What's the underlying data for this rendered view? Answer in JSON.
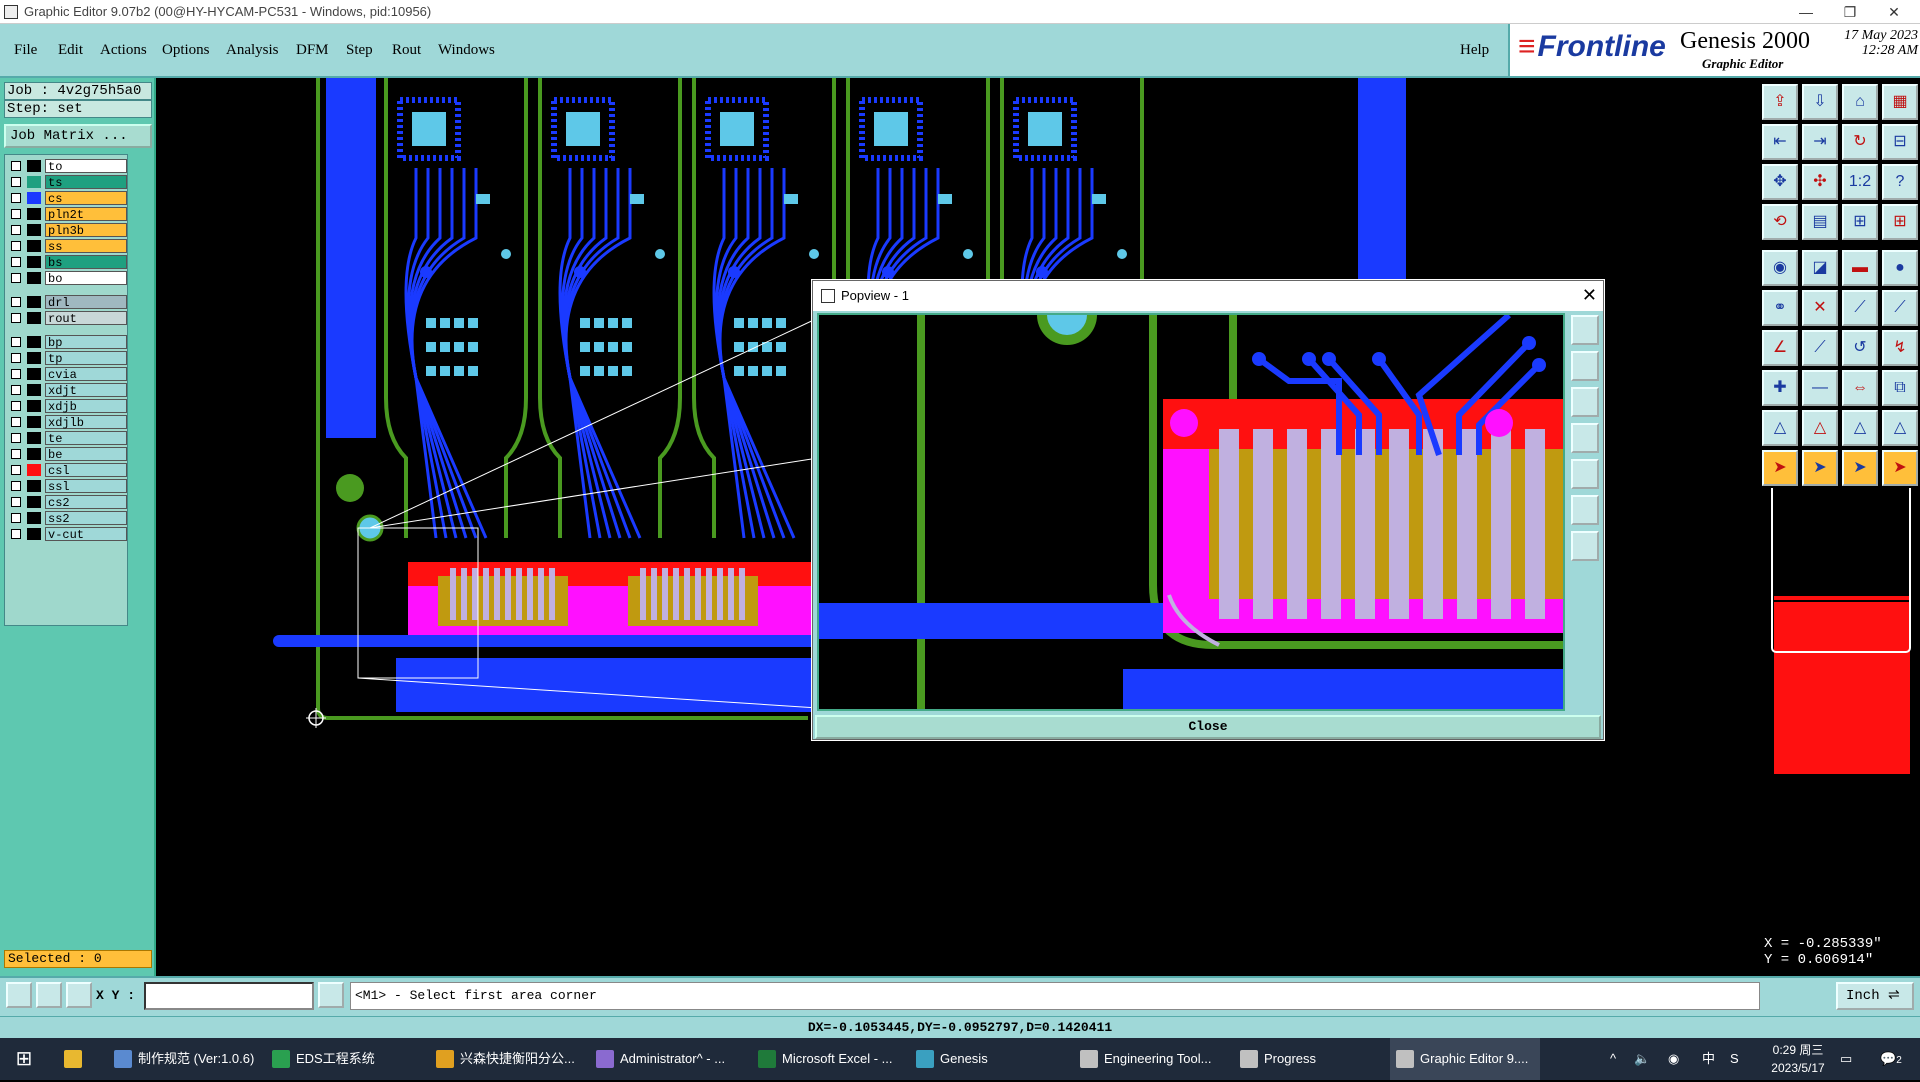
{
  "window": {
    "title": "Graphic Editor 9.07b2 (00@HY-HYCAM-PC531 - Windows, pid:10956)"
  },
  "menu": [
    "File",
    "Edit",
    "Actions",
    "Options",
    "Analysis",
    "DFM",
    "Step",
    "Rout",
    "Windows"
  ],
  "help": "Help",
  "brand": {
    "logo": "Frontline",
    "product": "Genesis 2000",
    "sub": "Graphic Editor",
    "date": "17 May 2023",
    "time": "12:28 AM"
  },
  "job": {
    "job_label": "Job : 4v2g75h5a0",
    "step_label": "Step: set",
    "matrix_button": "Job Matrix ..."
  },
  "layers": [
    {
      "name": "to",
      "color": "#ffffff",
      "swatch": "#000000"
    },
    {
      "name": "ts",
      "color": "#1fa080",
      "swatch": "#1fa080"
    },
    {
      "name": "cs",
      "color": "#ffbf3a",
      "swatch": "#1a3aff"
    },
    {
      "name": "pln2t",
      "color": "#ffbf3a",
      "swatch": "#000000"
    },
    {
      "name": "pln3b",
      "color": "#ffbf3a",
      "swatch": "#000000"
    },
    {
      "name": "ss",
      "color": "#ffbf3a",
      "swatch": "#000000"
    },
    {
      "name": "bs",
      "color": "#1fa080",
      "swatch": "#000000"
    },
    {
      "name": "bo",
      "color": "#ffffff",
      "swatch": "#000000"
    },
    {
      "name": "drl",
      "color": "#9fb8c0",
      "swatch": "#000000"
    },
    {
      "name": "rout",
      "color": "#c8d8d8",
      "swatch": "#000000"
    },
    {
      "name": "bp",
      "color": "#9fd8d8",
      "swatch": "#000000"
    },
    {
      "name": "tp",
      "color": "#9fd8d8",
      "swatch": "#000000"
    },
    {
      "name": "cvia",
      "color": "#9fd8d8",
      "swatch": "#000000"
    },
    {
      "name": "xdjt",
      "color": "#9fd8d8",
      "swatch": "#000000"
    },
    {
      "name": "xdjb",
      "color": "#9fd8d8",
      "swatch": "#000000"
    },
    {
      "name": "xdjlb",
      "color": "#9fd8d8",
      "swatch": "#000000"
    },
    {
      "name": "te",
      "color": "#9fd8d8",
      "swatch": "#000000"
    },
    {
      "name": "be",
      "color": "#9fd8d8",
      "swatch": "#000000"
    },
    {
      "name": "csl",
      "color": "#9fd8d8",
      "swatch": "#ff1010"
    },
    {
      "name": "ssl",
      "color": "#9fd8d8",
      "swatch": "#000000"
    },
    {
      "name": "cs2",
      "color": "#9fd8d8",
      "swatch": "#000000"
    },
    {
      "name": "ss2",
      "color": "#9fd8d8",
      "swatch": "#000000"
    },
    {
      "name": "v-cut",
      "color": "#9fd8d8",
      "swatch": "#000000"
    }
  ],
  "selected": "Selected : 0",
  "popview": {
    "title": "Popview - 1",
    "close": "Close"
  },
  "coords": {
    "x": "X = -0.285339\"",
    "y": "Y =  0.606914\""
  },
  "bottom": {
    "xy_label": "X Y :",
    "xy_value": "",
    "prompt": "<M1> - Select first area corner",
    "units": "Inch ⇌",
    "measure": "DX=-0.1053445,DY=-0.0952797,D=0.1420411"
  },
  "taskbar": [
    {
      "label": "制作规范 (Ver:1.0.6)",
      "color": "#5a8ad0"
    },
    {
      "label": "EDS工程系统",
      "color": "#2aa050"
    },
    {
      "label": "兴森快捷衡阳分公...",
      "color": "#e0a020"
    },
    {
      "label": "Administrator^ - ...",
      "color": "#8a6ad0"
    },
    {
      "label": "Microsoft Excel - ...",
      "color": "#1f7a3a"
    },
    {
      "label": "Genesis",
      "color": "#3aa0c0"
    },
    {
      "label": "Engineering Tool...",
      "color": "#c0c0c0"
    },
    {
      "label": "Progress",
      "color": "#c0c0c0"
    },
    {
      "label": "Graphic Editor 9....",
      "color": "#c0c0c0"
    }
  ],
  "tray": {
    "ime": "中",
    "time": "0:29 周三",
    "date": "2023/5/17",
    "notif": "2"
  },
  "colors": {
    "panel": "#9fd8d8",
    "trace": "#1a3aff",
    "outline": "#4a9a20",
    "pad": "#5ec8e8",
    "mask": "#ff10ff",
    "red": "#ff1010",
    "gold": "#c09a10"
  }
}
